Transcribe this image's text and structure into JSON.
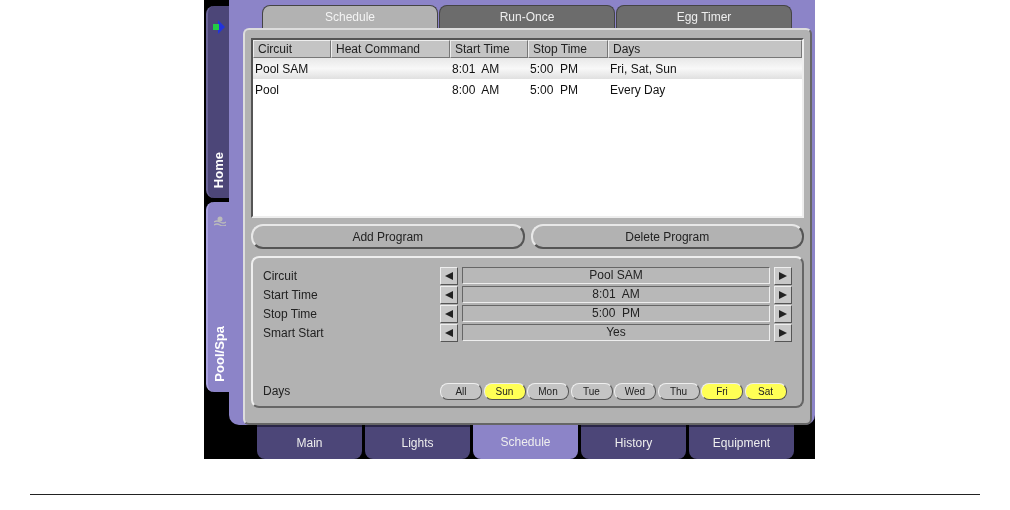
{
  "sidebar": {
    "tabs": [
      {
        "label": "Home",
        "selected": false
      },
      {
        "label": "Pool/Spa",
        "selected": true
      }
    ]
  },
  "top_tabs": [
    {
      "label": "Schedule",
      "selected": true
    },
    {
      "label": "Run-Once",
      "selected": false
    },
    {
      "label": "Egg Timer",
      "selected": false
    }
  ],
  "table": {
    "columns": [
      "Circuit",
      "Heat Command",
      "Start Time",
      "Stop Time",
      "Days"
    ],
    "rows": [
      {
        "cells": [
          "Pool SAM",
          "",
          "8:01  AM",
          "5:00  PM",
          "Fri, Sat, Sun"
        ],
        "selected": true
      },
      {
        "cells": [
          "Pool",
          "",
          "8:00  AM",
          "5:00  PM",
          "Every Day"
        ],
        "selected": false
      }
    ]
  },
  "buttons": [
    "Add Program",
    "Delete Program"
  ],
  "editor": {
    "fields": [
      {
        "label": "Circuit",
        "value": "Pool SAM"
      },
      {
        "label": "Start Time",
        "value": "8:01  AM"
      },
      {
        "label": "Stop Time",
        "value": "5:00  PM"
      },
      {
        "label": "Smart Start",
        "value": "Yes"
      }
    ],
    "days_label": "Days",
    "days": [
      {
        "label": "All",
        "selected": false
      },
      {
        "label": "Sun",
        "selected": true
      },
      {
        "label": "Mon",
        "selected": false
      },
      {
        "label": "Tue",
        "selected": false
      },
      {
        "label": "Wed",
        "selected": false
      },
      {
        "label": "Thu",
        "selected": false
      },
      {
        "label": "Fri",
        "selected": true
      },
      {
        "label": "Sat",
        "selected": true
      }
    ]
  },
  "bottom_tabs": [
    {
      "label": "Main",
      "selected": false
    },
    {
      "label": "Lights",
      "selected": false
    },
    {
      "label": "Schedule",
      "selected": true
    },
    {
      "label": "History",
      "selected": false
    },
    {
      "label": "Equipment",
      "selected": false
    }
  ]
}
